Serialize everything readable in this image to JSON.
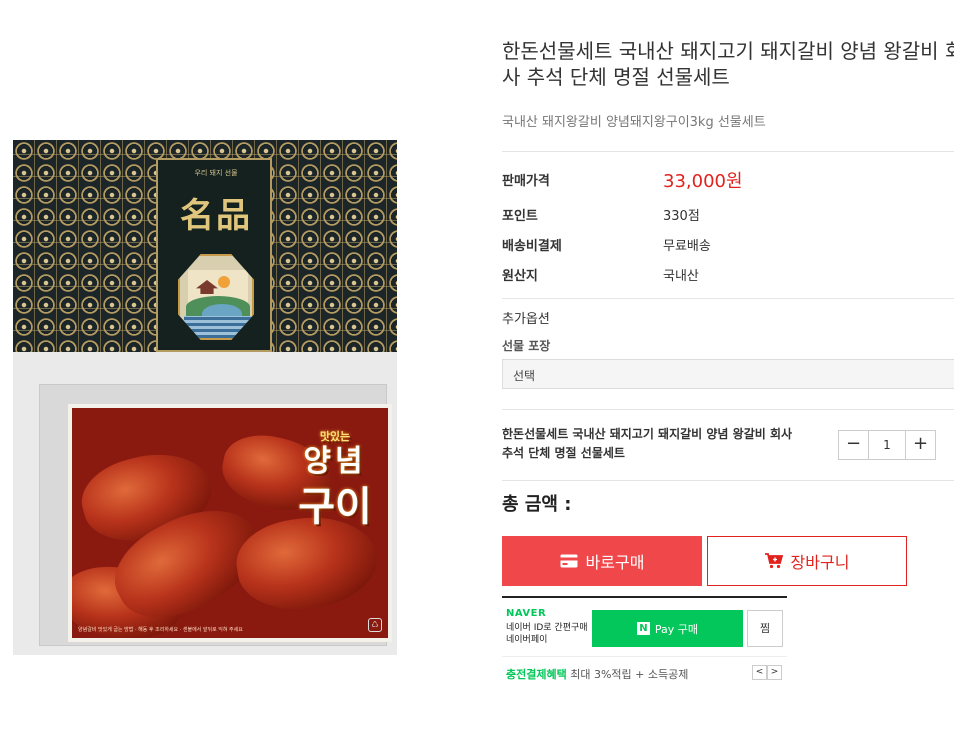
{
  "product": {
    "title_line1": "한돈선물세트 국내산 돼지고기 돼지갈비 양념 왕갈비 회",
    "title_line2": "사 추석 단체 명절 선물세트",
    "subtitle": "국내산 돼지왕갈비 양념돼지왕구이3kg 선물세트"
  },
  "image": {
    "box_hanja": "名品",
    "box_caption": "우리 돼지 선물",
    "label_small": "맛있는",
    "label_big1": "양념",
    "label_big2": "구이",
    "label_note": "양념갈비 맛있게 굽는 방법 · 해동 후 조리하세요 · 센불에서 앞뒤로 익혀 주세요",
    "recycle_mark": "♺"
  },
  "details": [
    {
      "key": "판매가격",
      "value": "33,000원"
    },
    {
      "key": "포인트",
      "value": "330점"
    },
    {
      "key": "배송비결제",
      "value": "무료배송"
    },
    {
      "key": "원산지",
      "value": "국내산"
    }
  ],
  "options": {
    "heading": "추가옵션",
    "label": "선물 포장",
    "selected": "선택"
  },
  "selection": {
    "name": "한돈선물세트 국내산 돼지고기 돼지갈비 양념 왕갈비 회사 추석 단체 명절 선물세트",
    "minus": "−",
    "quantity": "1",
    "plus": "+"
  },
  "total_label": "총 금액 :",
  "buttons": {
    "buy": "바로구매",
    "cart": "장바구니"
  },
  "npay": {
    "brand": "NAVER",
    "desc": "네이버 ID로 간편구매 네이버페이",
    "logo": "N",
    "pay_label": "Pay 구매",
    "wish": "찜",
    "benefit_highlight": "충전결제혜택",
    "benefit_text": "최대 3%적립 + 소득공제",
    "prev": "<",
    "next": ">"
  },
  "colors": {
    "price_red": "#e0231e",
    "buy_bg": "#f0474b",
    "naver_green": "#03c75a"
  }
}
